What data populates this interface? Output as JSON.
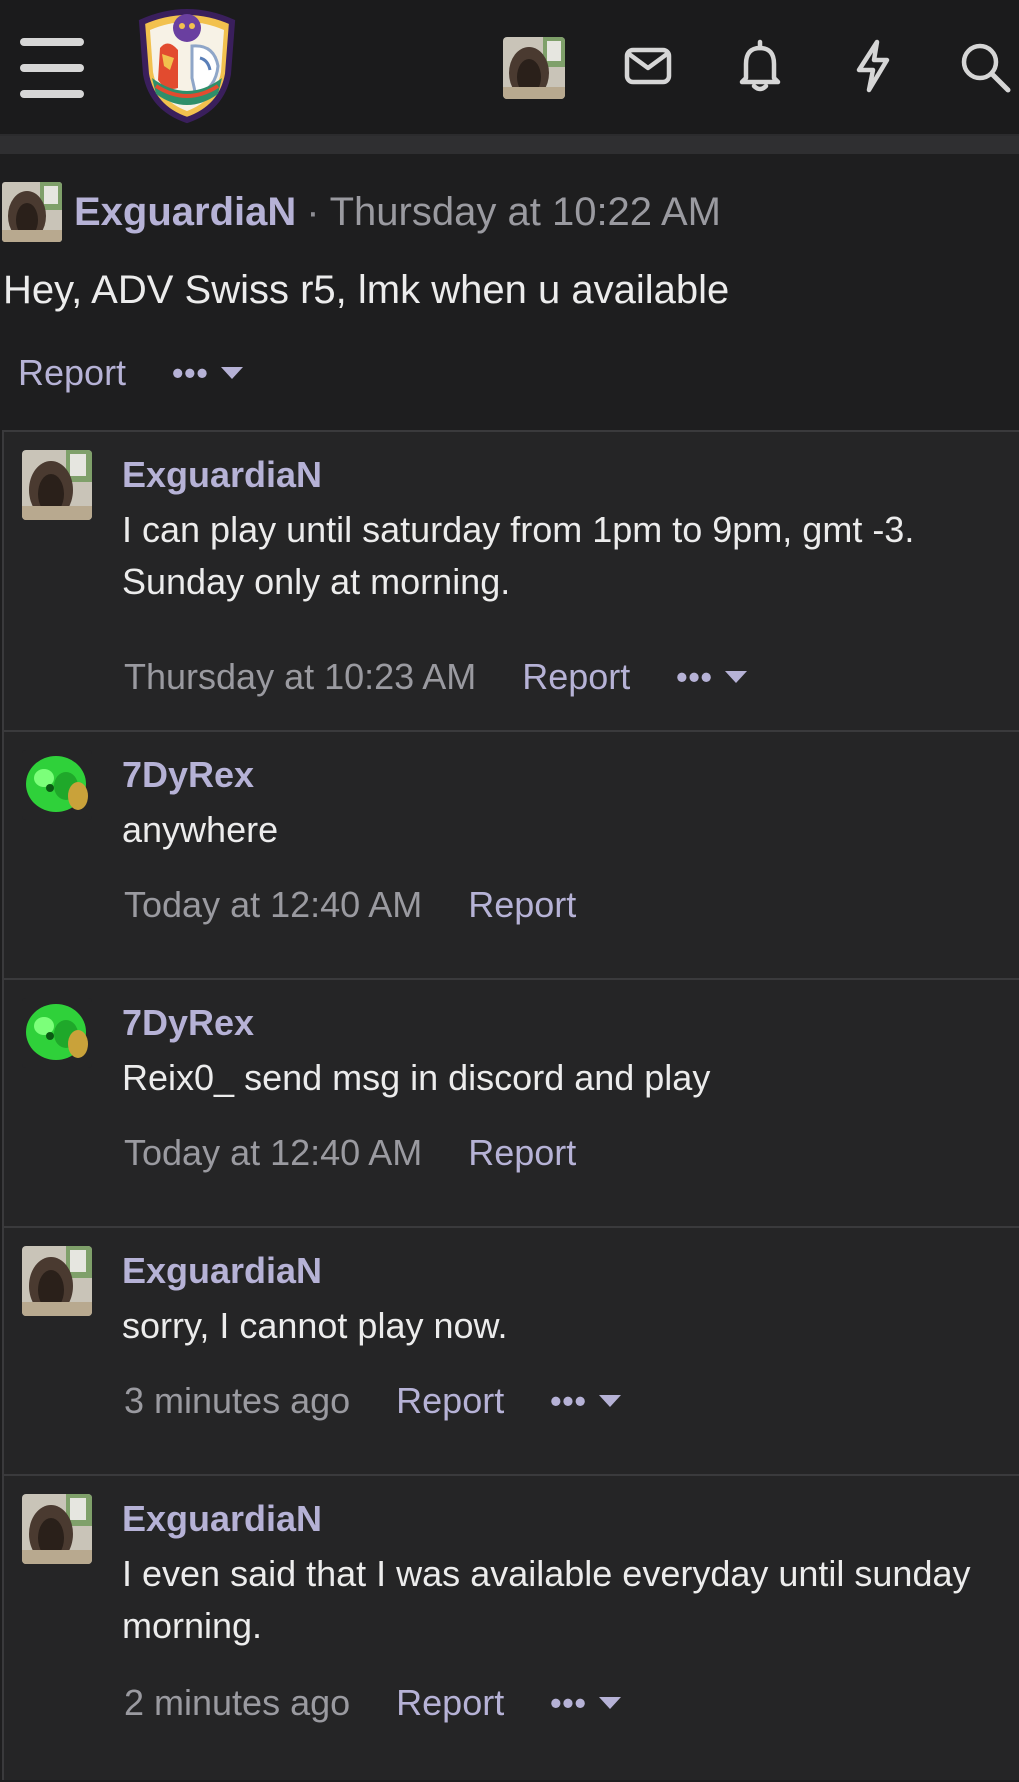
{
  "header": {
    "menu_icon": "hamburger-icon",
    "logo_icon": "forum-logo",
    "icons": [
      "user-avatar",
      "mail-icon",
      "bell-icon",
      "bolt-icon",
      "search-icon"
    ]
  },
  "main_post": {
    "username": "ExguardiaN",
    "separator": "·",
    "timestamp": "Thursday at 10:22 AM",
    "text": "Hey, ADV Swiss r5, lmk when u available",
    "report_label": "Report",
    "more_label": "•••"
  },
  "replies": [
    {
      "username": "ExguardiaN",
      "avatar": "avatar-exguardian",
      "text": "I can play until saturday from 1pm to 9pm, gmt -3. Sunday only at morning.",
      "timestamp": "Thursday at 10:23 AM",
      "report_label": "Report",
      "more_label": "•••"
    },
    {
      "username": "7DyRex",
      "avatar": "avatar-7dyrex",
      "text": "anywhere",
      "timestamp": "Today at 12:40 AM",
      "report_label": "Report"
    },
    {
      "username": "7DyRex",
      "avatar": "avatar-7dyrex",
      "text": "Reix0_ send msg in discord and play",
      "timestamp": "Today at 12:40 AM",
      "report_label": "Report"
    },
    {
      "username": "ExguardiaN",
      "avatar": "avatar-exguardian",
      "text": "sorry, I cannot play now.",
      "timestamp": "3 minutes ago",
      "report_label": "Report",
      "more_label": "•••"
    },
    {
      "username": "ExguardiaN",
      "avatar": "avatar-exguardian",
      "text": "I even said that I was available everyday until sunday morning.",
      "timestamp": "2 minutes ago",
      "report_label": "Report",
      "more_label": "•••"
    }
  ],
  "colors": {
    "background": "#1e1e1f",
    "reply_background": "#252526",
    "username": "#b6b2d6",
    "text": "#ececec",
    "muted": "#9a9aa0"
  }
}
